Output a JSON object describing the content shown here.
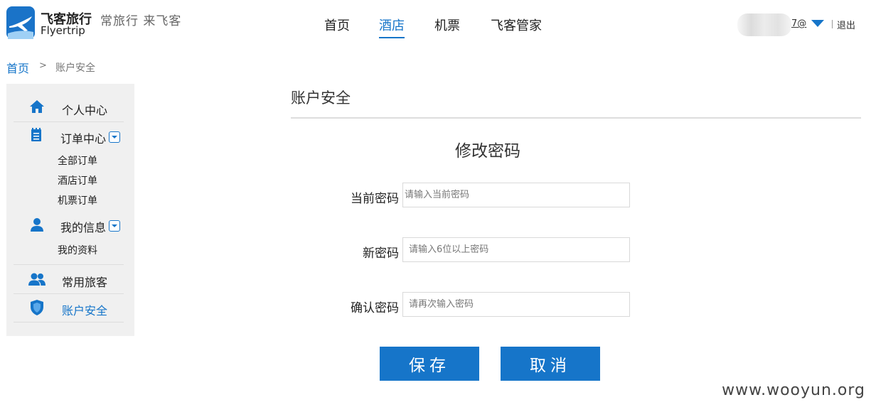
{
  "header": {
    "logo_cn": "飞客旅行",
    "logo_en": "Flyertrip",
    "slogan": "常旅行 来飞客",
    "nav": [
      {
        "label": "首页",
        "active": false
      },
      {
        "label": "酒店",
        "active": true
      },
      {
        "label": "机票",
        "active": false
      },
      {
        "label": "飞客管家",
        "active": false
      }
    ],
    "user_suffix": "7@",
    "logout": "退出"
  },
  "breadcrumb": {
    "home": "首页",
    "separator": ">",
    "current": "账户安全"
  },
  "sidebar": {
    "personal_center": "个人中心",
    "order_center": "订单中心",
    "orders": [
      "全部订单",
      "酒店订单",
      "机票订单"
    ],
    "my_info": "我的信息",
    "my_profile": "我的资料",
    "frequent_travelers": "常用旅客",
    "account_security": "账户安全"
  },
  "main": {
    "title": "账户安全",
    "form_title": "修改密码",
    "fields": [
      {
        "label": "当前密码",
        "placeholder": "请输入当前密码"
      },
      {
        "label": "新密码",
        "placeholder": "请输入6位以上密码"
      },
      {
        "label": "确认密码",
        "placeholder": "请再次输入密码"
      }
    ],
    "save_label": "保存",
    "cancel_label": "取消"
  },
  "watermark": "www.wooyun.org",
  "colors": {
    "accent": "#1675c9",
    "sidebar_bg": "#f0f0f0"
  }
}
